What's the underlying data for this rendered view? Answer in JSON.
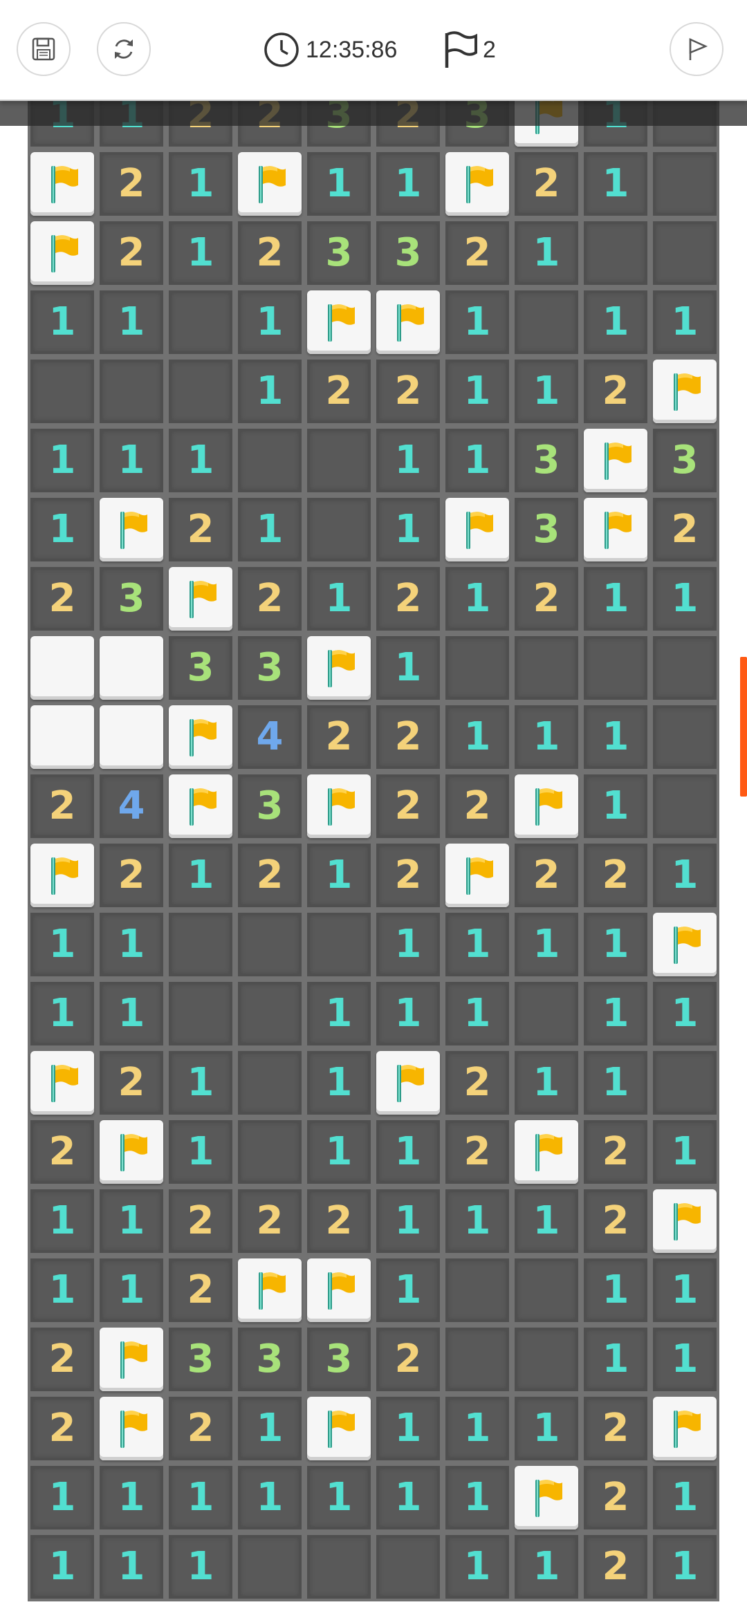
{
  "header": {
    "save_icon": "save-icon",
    "restart_icon": "refresh-icon",
    "timer_icon": "clock-icon",
    "timer": "12:35:86",
    "flag_icon": "flag-outline-icon",
    "flags_count": "2",
    "finish_icon": "flag-button-icon"
  },
  "colors": {
    "one": "#52dfd0",
    "two": "#f4d27a",
    "three": "#a8e27a",
    "four": "#6fa8ec",
    "flag": "#f7b500",
    "scroll_thumb": "#ff5a14"
  },
  "board": {
    "legend": "F = flagged cell, H = unrevealed cell, 0 = empty revealed, digit = adjacent mine count",
    "rows": [
      "1122323F1 ",
      "F21F11F210",
      "F21233210",
      "110 1FF10 1 1",
      "000122112F",
      "1110011F3",
      "1F210F13F2",
      "23F2121211",
      "HH33F10000",
      "HHF4221110",
      "24F3F22F10",
      "F212121F221",
      "1100011 11F",
      "1100111011",
      "F2101F2110",
      "2F1011 2F21",
      "1122211 12F",
      "112FF10011",
      "2F33320011",
      "2F21F1112F",
      "111111 1F21",
      "1110001121"
    ],
    "grid": [
      [
        "1",
        "1",
        "2",
        "2",
        "3",
        "2",
        "3",
        "F",
        "1",
        "0"
      ],
      [
        "F",
        "2",
        "1",
        "F",
        "1",
        "1",
        "F",
        "2",
        "1",
        "0"
      ],
      [
        "F",
        "2",
        "1",
        "2",
        "3",
        "3",
        "2",
        "1",
        "0",
        "0"
      ],
      [
        "1",
        "1",
        "0",
        "1",
        "F",
        "F",
        "1",
        "0",
        "1",
        "1"
      ],
      [
        "0",
        "0",
        "0",
        "1",
        "2",
        "2",
        "1",
        "1",
        "2",
        "F"
      ],
      [
        "1",
        "1",
        "1",
        "0",
        "0",
        "1",
        "1",
        "3",
        "F",
        "3"
      ],
      [
        "1",
        "F",
        "2",
        "1",
        "0",
        "1",
        "F",
        "3",
        "F",
        "2"
      ],
      [
        "2",
        "3",
        "F",
        "2",
        "1",
        "2",
        "1",
        "2",
        "1",
        "1"
      ],
      [
        "H",
        "H",
        "3",
        "3",
        "F",
        "1",
        "0",
        "0",
        "0",
        "0"
      ],
      [
        "H",
        "H",
        "F",
        "4",
        "2",
        "2",
        "1",
        "1",
        "1",
        "0"
      ],
      [
        "2",
        "4",
        "F",
        "3",
        "F",
        "2",
        "2",
        "F",
        "1",
        "0"
      ],
      [
        "F",
        "2",
        "1",
        "2",
        "1",
        "2",
        "F",
        "2",
        "2",
        "1"
      ],
      [
        "1",
        "1",
        "0",
        "0",
        "0",
        "1",
        "1",
        "1",
        "1",
        "F"
      ],
      [
        "1",
        "1",
        "0",
        "0",
        "1",
        "1",
        "1",
        "0",
        "1",
        "1"
      ],
      [
        "F",
        "2",
        "1",
        "0",
        "1",
        "F",
        "2",
        "1",
        "1",
        "0"
      ],
      [
        "2",
        "F",
        "1",
        "0",
        "1",
        "1",
        "2",
        "F",
        "2",
        "1"
      ],
      [
        "1",
        "1",
        "2",
        "2",
        "2",
        "1",
        "1",
        "1",
        "2",
        "F"
      ],
      [
        "1",
        "1",
        "2",
        "F",
        "F",
        "1",
        "0",
        "0",
        "1",
        "1"
      ],
      [
        "2",
        "F",
        "3",
        "3",
        "3",
        "2",
        "0",
        "0",
        "1",
        "1"
      ],
      [
        "2",
        "F",
        "2",
        "1",
        "F",
        "1",
        "1",
        "1",
        "2",
        "F"
      ],
      [
        "1",
        "1",
        "1",
        "1",
        "1",
        "1",
        "1",
        "F",
        "2",
        "1"
      ],
      [
        "1",
        "1",
        "1",
        "0",
        "0",
        "0",
        "1",
        "1",
        "2",
        "1"
      ]
    ]
  }
}
